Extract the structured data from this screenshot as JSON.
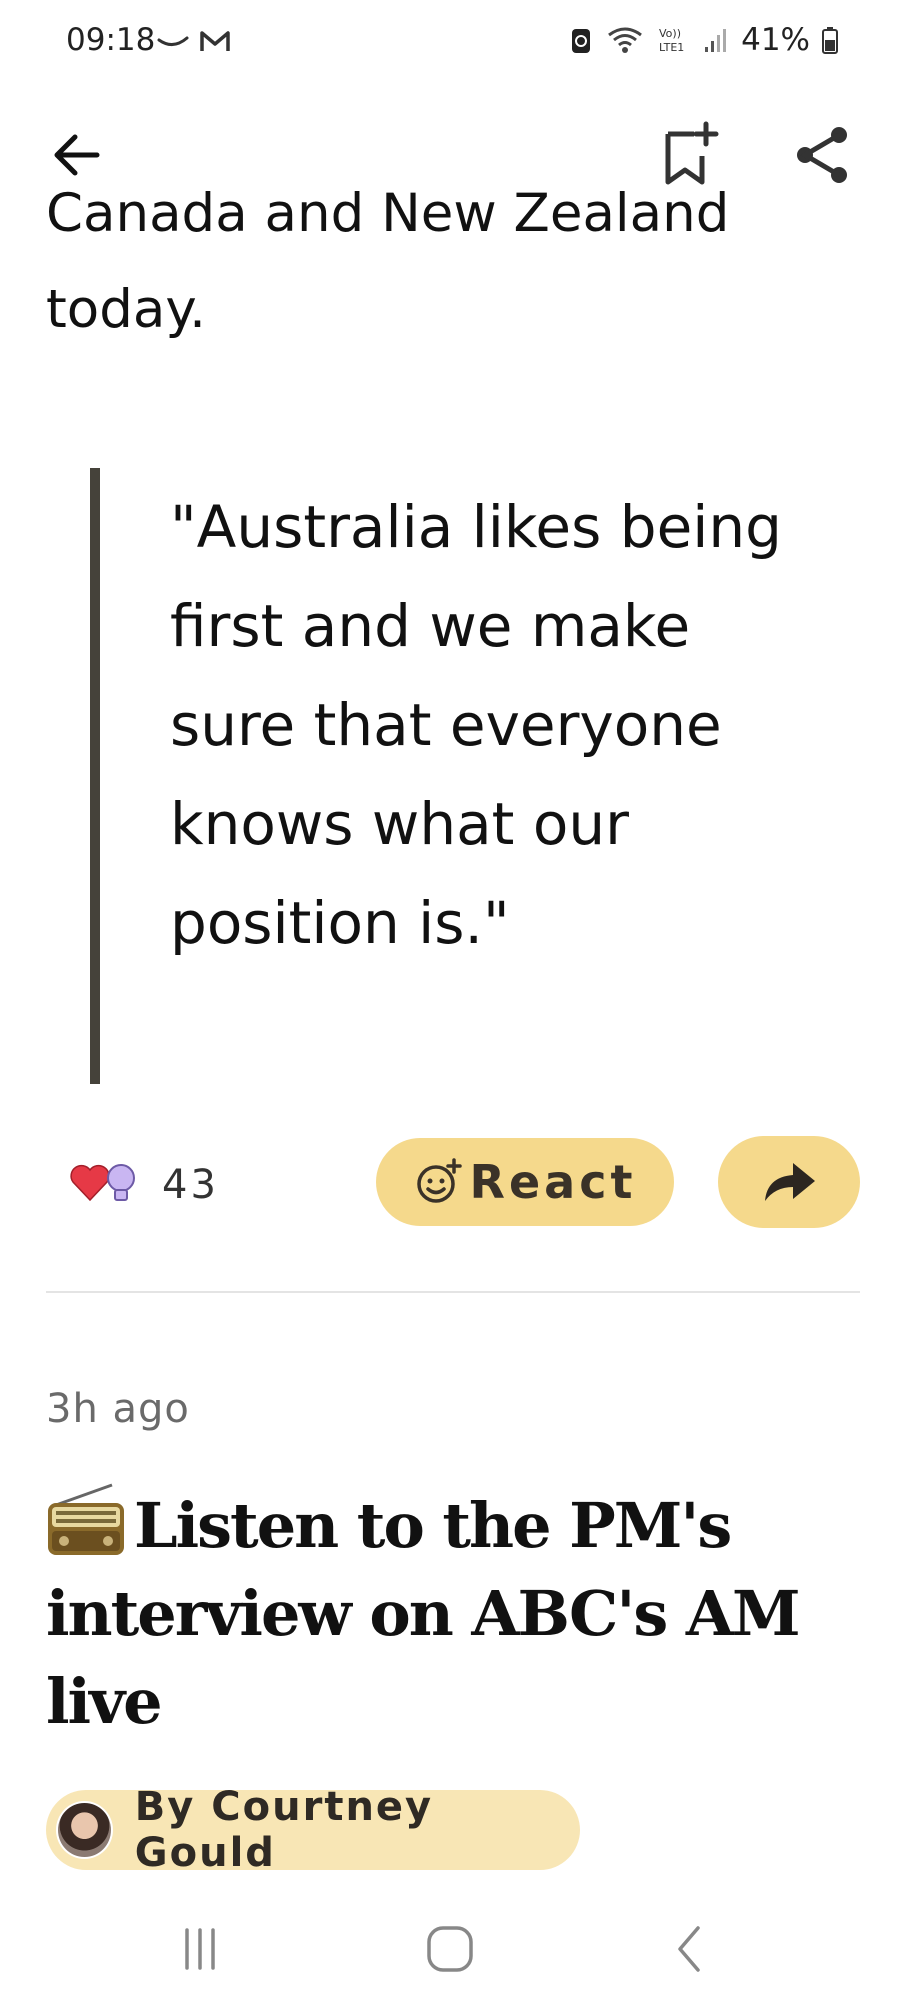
{
  "status_bar": {
    "time": "09:18",
    "battery": "41%",
    "icons": [
      "curve-icon",
      "gmail-icon",
      "data-saver-icon",
      "wifi-icon",
      "volte-icon",
      "signal-icon",
      "battery-icon"
    ]
  },
  "top_bar": {
    "icons": [
      "back-arrow-icon",
      "bookmark-add-icon",
      "share-icon"
    ]
  },
  "article": {
    "cut_line": "Canada and New Zealand",
    "line2": "today.",
    "quote": "\"Australia likes being first and we make sure that everyone knows what our position is.\""
  },
  "reactions": {
    "count": "43",
    "icons": [
      "heart-icon",
      "lightbulb-icon"
    ],
    "react_label": "React",
    "react_icon": "add-reaction-icon",
    "share_icon": "forward-arrow-icon"
  },
  "post": {
    "timestamp": "3h ago",
    "title": "Listen to the PM's interview on ABC's AM live",
    "title_icon": "radio-emoji",
    "byline": "By Courtney Gould"
  },
  "nav_bar": {
    "icons": [
      "recent-apps-icon",
      "home-icon",
      "back-icon"
    ]
  },
  "colors": {
    "accent_yellow": "#f5d98c",
    "byline_bg": "#f8e6b5",
    "quote_bar": "#45423a"
  }
}
